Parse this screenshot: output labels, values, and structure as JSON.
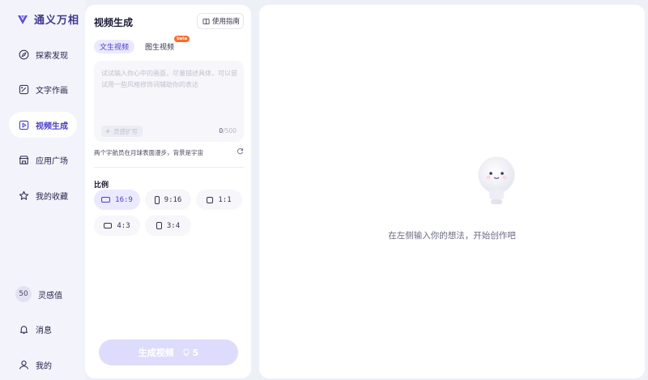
{
  "app": {
    "name": "通义万相"
  },
  "sidebar": {
    "items": [
      {
        "label": "探索发现",
        "icon": "compass-icon"
      },
      {
        "label": "文字作画",
        "icon": "image-edit-icon"
      },
      {
        "label": "视频生成",
        "icon": "video-icon",
        "active": true
      },
      {
        "label": "应用广场",
        "icon": "app-store-icon"
      },
      {
        "label": "我的收藏",
        "icon": "star-icon"
      }
    ],
    "credits": {
      "value": "50",
      "label": "灵感值"
    },
    "messages": {
      "label": "消息",
      "icon": "bell-icon"
    },
    "profile": {
      "label": "我的",
      "icon": "user-icon"
    }
  },
  "panel": {
    "title": "视频生成",
    "guide_label": "使用指南",
    "tabs": [
      {
        "label": "文生视频",
        "active": true
      },
      {
        "label": "图生视频",
        "badge": "beta"
      }
    ],
    "prompt": {
      "placeholder": "试试输入你心中的画面，尽量描述具体，可以尝试用一些风格修饰词辅助你的表达",
      "value": "",
      "expand_label": "灵感扩写",
      "count": "0",
      "max": "/500"
    },
    "suggestion": "两个宇航员在月球表面漫步，背景是宇宙",
    "ratio_label": "比例",
    "ratios": [
      {
        "label": "16:9",
        "active": true
      },
      {
        "label": "9:16"
      },
      {
        "label": "1:1"
      },
      {
        "label": "4:3"
      },
      {
        "label": "3:4"
      }
    ],
    "generate": {
      "label": "生成视频",
      "cost": "5"
    }
  },
  "main": {
    "empty_text": "在左侧输入你的想法，开始创作吧"
  },
  "colors": {
    "accent": "#4b3ec9",
    "accent_soft": "#ebe9ff",
    "generate_disabled": "#dddcfc",
    "beta_badge": "#ff6a2c"
  }
}
